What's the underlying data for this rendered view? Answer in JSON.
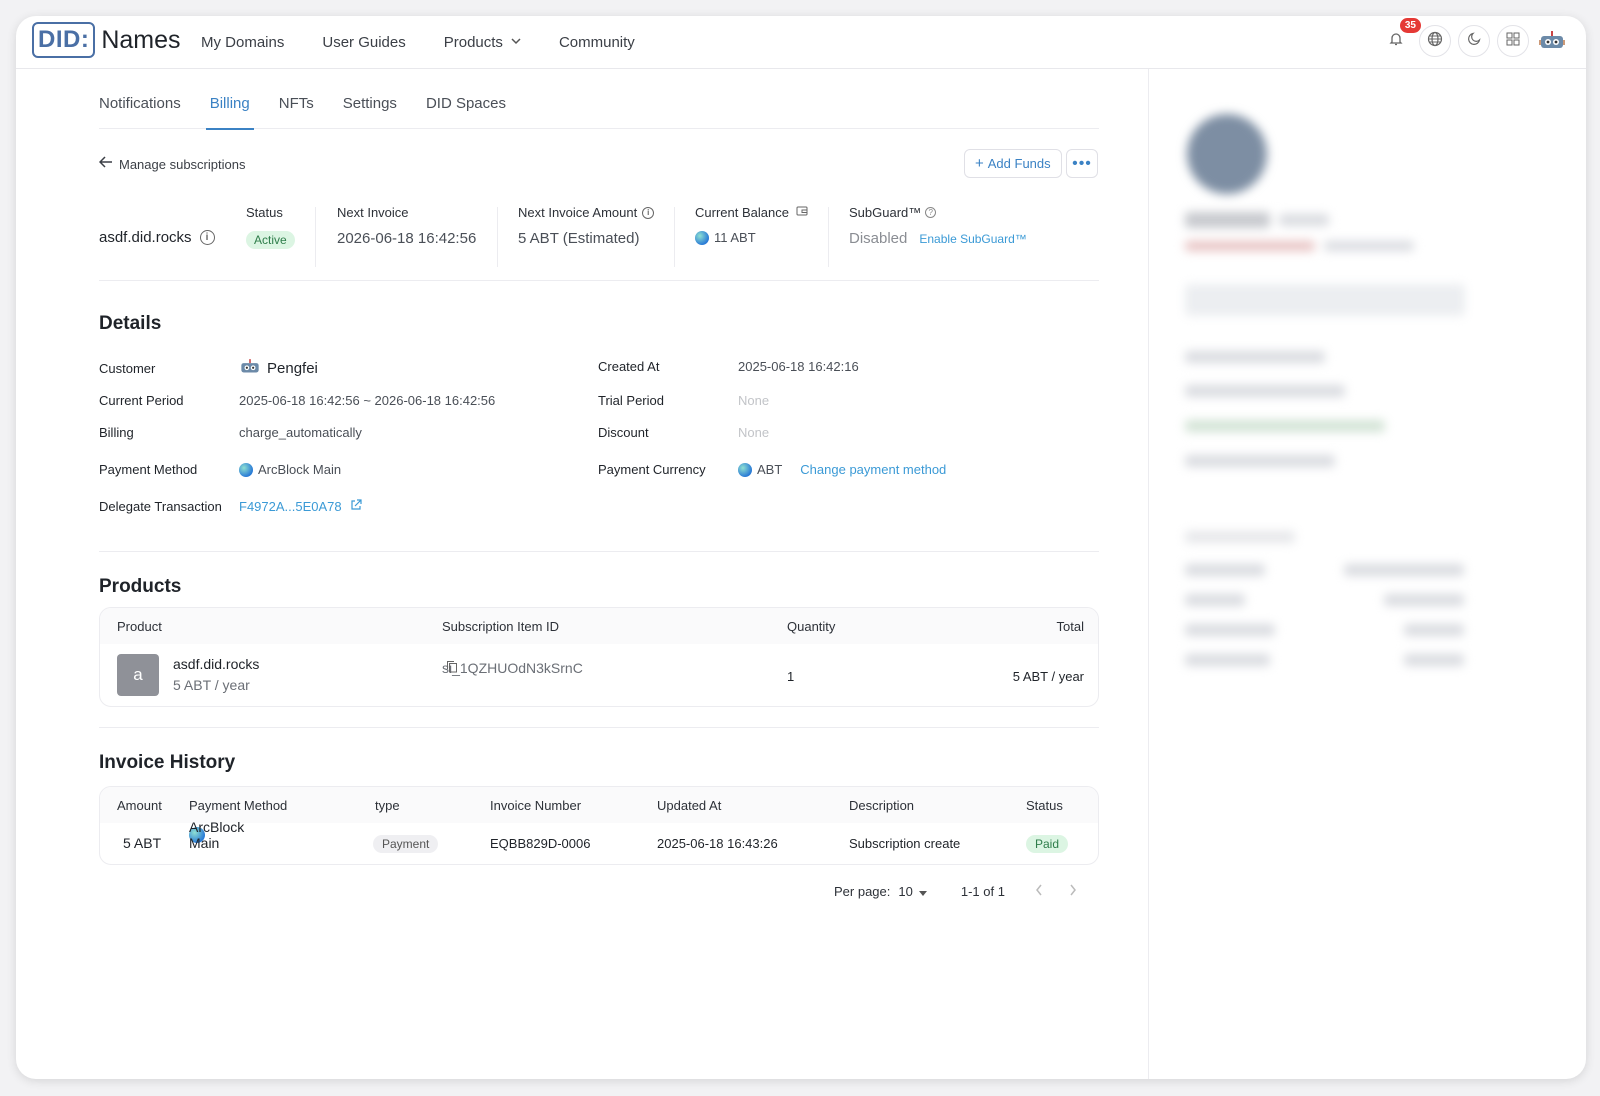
{
  "header": {
    "logo_prefix": "DID:",
    "logo_name": "Names",
    "nav": [
      {
        "label": "My Domains"
      },
      {
        "label": "User Guides"
      },
      {
        "label": "Products"
      },
      {
        "label": "Community"
      }
    ],
    "notification_count": "35",
    "icons": [
      "bell-icon",
      "globe-icon",
      "moon-icon",
      "grid-icon",
      "robot-avatar-icon"
    ]
  },
  "tabs": [
    {
      "label": "Notifications"
    },
    {
      "label": "Billing"
    },
    {
      "label": "NFTs"
    },
    {
      "label": "Settings"
    },
    {
      "label": "DID Spaces"
    }
  ],
  "back_link": "Manage subscriptions",
  "actions": {
    "add_funds": "Add Funds",
    "more": "•••"
  },
  "summary": {
    "name": "asdf.did.rocks",
    "status_label": "Status",
    "status_value": "Active",
    "next_invoice_label": "Next Invoice",
    "next_invoice_value": "2026-06-18 16:42:56",
    "next_amount_label": "Next Invoice Amount",
    "next_amount_value": "5 ABT (Estimated)",
    "balance_label": "Current Balance",
    "balance_value": "11 ABT",
    "subguard_label": "SubGuard™",
    "subguard_value": "Disabled",
    "subguard_link": "Enable SubGuard™"
  },
  "details": {
    "title": "Details",
    "customer_label": "Customer",
    "customer_value": "Pengfei",
    "period_label": "Current Period",
    "period_value": "2025-06-18 16:42:56 ~ 2026-06-18 16:42:56",
    "billing_label": "Billing",
    "billing_value": "charge_automatically",
    "method_label": "Payment Method",
    "method_value": "ArcBlock Main",
    "delegate_label": "Delegate Transaction",
    "delegate_value": "F4972A...5E0A78",
    "created_label": "Created At",
    "created_value": "2025-06-18 16:42:16",
    "trial_label": "Trial Period",
    "trial_value": "None",
    "discount_label": "Discount",
    "discount_value": "None",
    "currency_label": "Payment Currency",
    "currency_value": "ABT",
    "change_method": "Change payment method"
  },
  "products": {
    "title": "Products",
    "columns": [
      "Product",
      "Subscription Item ID",
      "Quantity",
      "Total"
    ],
    "rows": [
      {
        "thumb": "a",
        "name": "asdf.did.rocks",
        "price": "5 ABT / year",
        "item_id": "si_1QZHUOdN3kSrnC",
        "quantity": "1",
        "total": "5 ABT / year"
      }
    ]
  },
  "invoices": {
    "title": "Invoice History",
    "columns": [
      "Amount",
      "Payment Method",
      "type",
      "Invoice Number",
      "Updated At",
      "Description",
      "Status"
    ],
    "rows": [
      {
        "amount": "5 ABT",
        "method": "ArcBlock Main",
        "type": "Payment",
        "number": "EQBB829D-0006",
        "updated": "2025-06-18 16:43:26",
        "description": "Subscription create",
        "status": "Paid"
      }
    ]
  },
  "pagination": {
    "per_page_label": "Per page:",
    "per_page": "10",
    "range": "1-1 of 1"
  },
  "colors": {
    "accent": "#3b82c4",
    "link": "#3b9ad6",
    "success_bg": "#dcf5e3",
    "success_text": "#2e7d4a",
    "badge": "#e53935"
  }
}
